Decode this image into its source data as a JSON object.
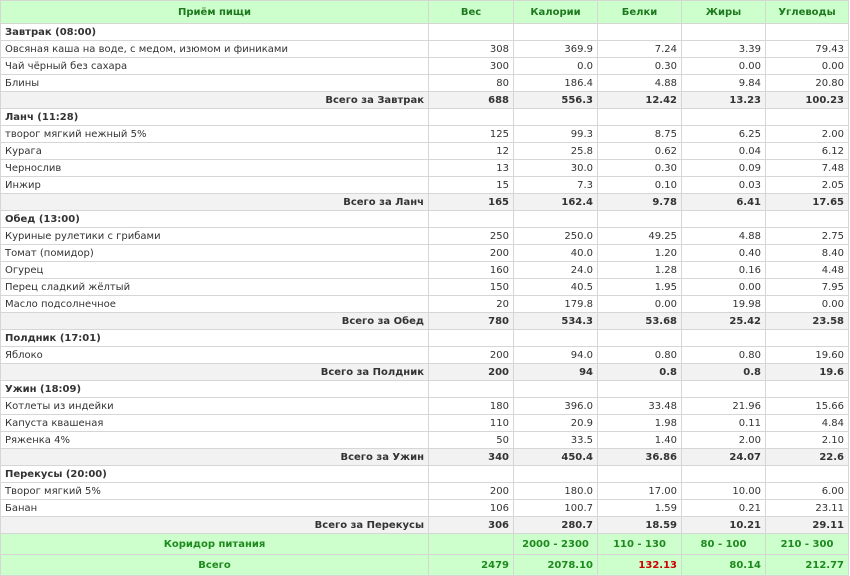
{
  "headers": {
    "meal": "Приём пищи",
    "weight": "Вес",
    "calories": "Калории",
    "protein": "Белки",
    "fat": "Жиры",
    "carbs": "Углеводы"
  },
  "meals": [
    {
      "title": "Завтрак (08:00)",
      "items": [
        {
          "name": "Овсяная каша на воде, с медом, изюмом и финиками",
          "weight": "308",
          "calories": "369.9",
          "protein": "7.24",
          "fat": "3.39",
          "carbs": "79.43"
        },
        {
          "name": "Чай чёрный без сахара",
          "weight": "300",
          "calories": "0.0",
          "protein": "0.30",
          "fat": "0.00",
          "carbs": "0.00"
        },
        {
          "name": "Блины",
          "weight": "80",
          "calories": "186.4",
          "protein": "4.88",
          "fat": "9.84",
          "carbs": "20.80"
        }
      ],
      "total": {
        "label": "Всего за Завтрак",
        "weight": "688",
        "calories": "556.3",
        "protein": "12.42",
        "fat": "13.23",
        "carbs": "100.23"
      }
    },
    {
      "title": "Ланч (11:28)",
      "items": [
        {
          "name": "творог мягкий нежный 5%",
          "weight": "125",
          "calories": "99.3",
          "protein": "8.75",
          "fat": "6.25",
          "carbs": "2.00"
        },
        {
          "name": "Курага",
          "weight": "12",
          "calories": "25.8",
          "protein": "0.62",
          "fat": "0.04",
          "carbs": "6.12"
        },
        {
          "name": "Чернослив",
          "weight": "13",
          "calories": "30.0",
          "protein": "0.30",
          "fat": "0.09",
          "carbs": "7.48"
        },
        {
          "name": "Инжир",
          "weight": "15",
          "calories": "7.3",
          "protein": "0.10",
          "fat": "0.03",
          "carbs": "2.05"
        }
      ],
      "total": {
        "label": "Всего за Ланч",
        "weight": "165",
        "calories": "162.4",
        "protein": "9.78",
        "fat": "6.41",
        "carbs": "17.65"
      }
    },
    {
      "title": "Обед (13:00)",
      "items": [
        {
          "name": "Куриные рулетики с грибами",
          "weight": "250",
          "calories": "250.0",
          "protein": "49.25",
          "fat": "4.88",
          "carbs": "2.75"
        },
        {
          "name": "Томат (помидор)",
          "weight": "200",
          "calories": "40.0",
          "protein": "1.20",
          "fat": "0.40",
          "carbs": "8.40"
        },
        {
          "name": "Огурец",
          "weight": "160",
          "calories": "24.0",
          "protein": "1.28",
          "fat": "0.16",
          "carbs": "4.48"
        },
        {
          "name": "Перец сладкий жёлтый",
          "weight": "150",
          "calories": "40.5",
          "protein": "1.95",
          "fat": "0.00",
          "carbs": "7.95"
        },
        {
          "name": "Масло подсолнечное",
          "weight": "20",
          "calories": "179.8",
          "protein": "0.00",
          "fat": "19.98",
          "carbs": "0.00"
        }
      ],
      "total": {
        "label": "Всего за Обед",
        "weight": "780",
        "calories": "534.3",
        "protein": "53.68",
        "fat": "25.42",
        "carbs": "23.58"
      }
    },
    {
      "title": "Полдник (17:01)",
      "items": [
        {
          "name": "Яблоко",
          "weight": "200",
          "calories": "94.0",
          "protein": "0.80",
          "fat": "0.80",
          "carbs": "19.60"
        }
      ],
      "total": {
        "label": "Всего за Полдник",
        "weight": "200",
        "calories": "94",
        "protein": "0.8",
        "fat": "0.8",
        "carbs": "19.6"
      }
    },
    {
      "title": "Ужин (18:09)",
      "items": [
        {
          "name": "Котлеты из индейки",
          "weight": "180",
          "calories": "396.0",
          "protein": "33.48",
          "fat": "21.96",
          "carbs": "15.66"
        },
        {
          "name": "Капуста квашеная",
          "weight": "110",
          "calories": "20.9",
          "protein": "1.98",
          "fat": "0.11",
          "carbs": "4.84"
        },
        {
          "name": "Ряженка 4%",
          "weight": "50",
          "calories": "33.5",
          "protein": "1.40",
          "fat": "2.00",
          "carbs": "2.10"
        }
      ],
      "total": {
        "label": "Всего за Ужин",
        "weight": "340",
        "calories": "450.4",
        "protein": "36.86",
        "fat": "24.07",
        "carbs": "22.6"
      }
    },
    {
      "title": "Перекусы (20:00)",
      "items": [
        {
          "name": "Творог мягкий 5%",
          "weight": "200",
          "calories": "180.0",
          "protein": "17.00",
          "fat": "10.00",
          "carbs": "6.00"
        },
        {
          "name": "Банан",
          "weight": "106",
          "calories": "100.7",
          "protein": "1.59",
          "fat": "0.21",
          "carbs": "23.11"
        }
      ],
      "total": {
        "label": "Всего за Перекусы",
        "weight": "306",
        "calories": "280.7",
        "protein": "18.59",
        "fat": "10.21",
        "carbs": "29.11"
      }
    }
  ],
  "corridor": {
    "label": "Коридор питания",
    "weight": "",
    "calories": "2000 - 2300",
    "protein": "110 - 130",
    "fat": "80 - 100",
    "carbs": "210 - 300"
  },
  "grand_total": {
    "label": "Всего",
    "weight": "2479",
    "calories": "2078.10",
    "protein": "132.13",
    "fat": "80.14",
    "carbs": "212.77"
  },
  "colors": {
    "header_bg": "#ccffcc",
    "header_text": "#1e7a1e",
    "warning": "#cc0000"
  }
}
